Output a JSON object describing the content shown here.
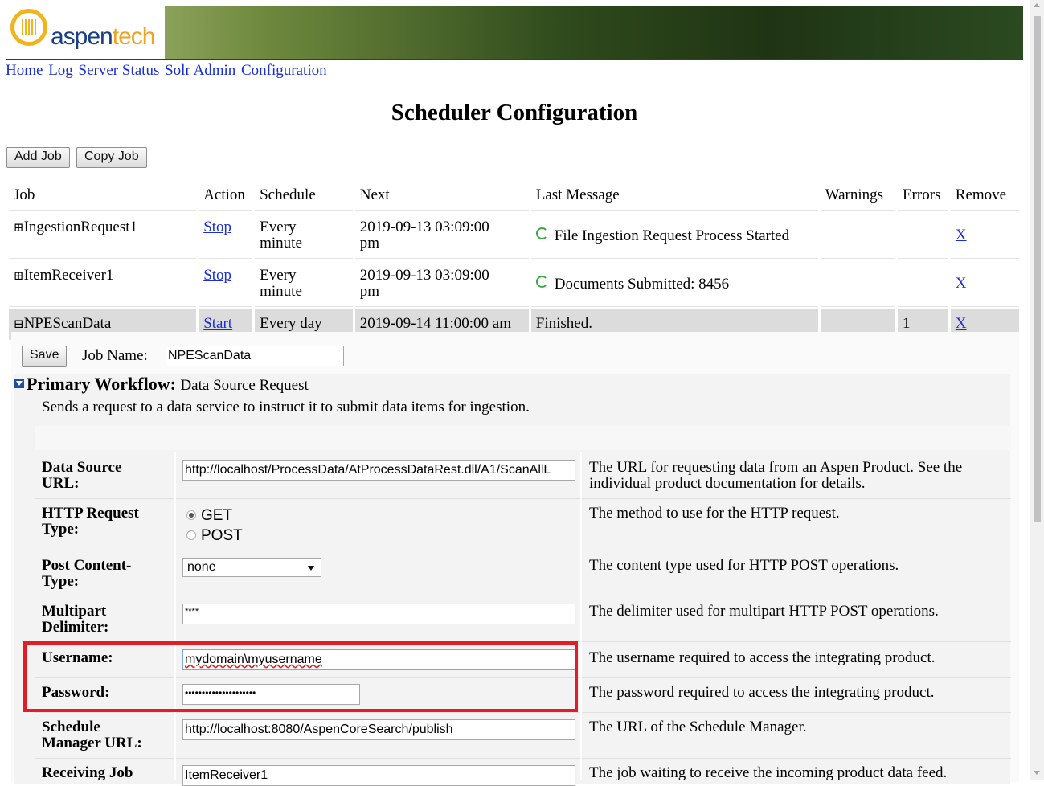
{
  "brand": {
    "logo_a": "aspen",
    "logo_b": "tech"
  },
  "nav": [
    "Home",
    "Log",
    "Server Status",
    "Solr Admin",
    "Configuration"
  ],
  "title": "Scheduler Configuration",
  "toolbar": {
    "add_job": "Add Job",
    "copy_job": "Copy Job"
  },
  "table": {
    "headers": [
      "Job",
      "Action",
      "Schedule",
      "Next",
      "Last Message",
      "Warnings",
      "Errors",
      "Remove"
    ],
    "rows": [
      {
        "toggle": "⊞",
        "job": "IngestionRequest1",
        "action": "Stop",
        "schedule_1": "Every",
        "schedule_2": "minute",
        "next_1": "2019-09-13 03:09:00",
        "next_2": "pm",
        "message": "File Ingestion Request Process Started",
        "warnings": "",
        "errors": "",
        "remove": "X"
      },
      {
        "toggle": "⊞",
        "job": "ItemReceiver1",
        "action": "Stop",
        "schedule_1": "Every",
        "schedule_2": "minute",
        "next_1": "2019-09-13 03:09:00",
        "next_2": "pm",
        "message": "Documents Submitted: 8456",
        "warnings": "",
        "errors": "",
        "remove": "X"
      },
      {
        "toggle": "⊟",
        "job": "NPEScanData",
        "action": "Start",
        "schedule_1": "Every day",
        "schedule_2": "",
        "next_1": "2019-09-14 11:00:00 am",
        "next_2": "",
        "message": "Finished.",
        "warnings": "",
        "errors": "1",
        "remove": "X"
      }
    ]
  },
  "detail": {
    "save": "Save",
    "job_name_label": "Job Name:",
    "job_name_value": "NPEScanData",
    "workflow_label": "Primary Workflow:",
    "workflow_name": "Data Source Request",
    "workflow_desc": "Sends a request to a data service to instruct it to submit data items for ingestion.",
    "fields": {
      "url": {
        "l1": "Data Source",
        "l2": "URL:",
        "value": "http://localhost/ProcessData/AtProcessDataRest.dll/A1/ScanAllL",
        "d1": "The URL for requesting data from an Aspen Product. See the",
        "d2": "individual product documentation for details."
      },
      "http": {
        "l1": "HTTP Request",
        "l2": "Type:",
        "opt1": "GET",
        "opt2": "POST",
        "desc": "The method to use for the HTTP request."
      },
      "content": {
        "l1": "Post Content-",
        "l2": "Type:",
        "value": "none",
        "desc": "The content type used for HTTP POST operations."
      },
      "multipart": {
        "l1": "Multipart",
        "l2": "Delimiter:",
        "value": "****",
        "desc": "The delimiter used for multipart HTTP POST operations."
      },
      "username": {
        "label": "Username:",
        "value": "mydomain\\myusername",
        "desc": "The username required to access the integrating product."
      },
      "password": {
        "label": "Password:",
        "value": "•••••••••••••••••••••",
        "desc": "The password required to access the integrating product."
      },
      "schedule_mgr": {
        "l1": "Schedule",
        "l2": "Manager URL:",
        "value": "http://localhost:8080/AspenCoreSearch/publish",
        "desc": "The URL of the Schedule Manager."
      },
      "receiving": {
        "l1": "Receiving Job",
        "value": "ItemReceiver1",
        "desc": "The job waiting to receive the incoming product data feed."
      }
    }
  }
}
